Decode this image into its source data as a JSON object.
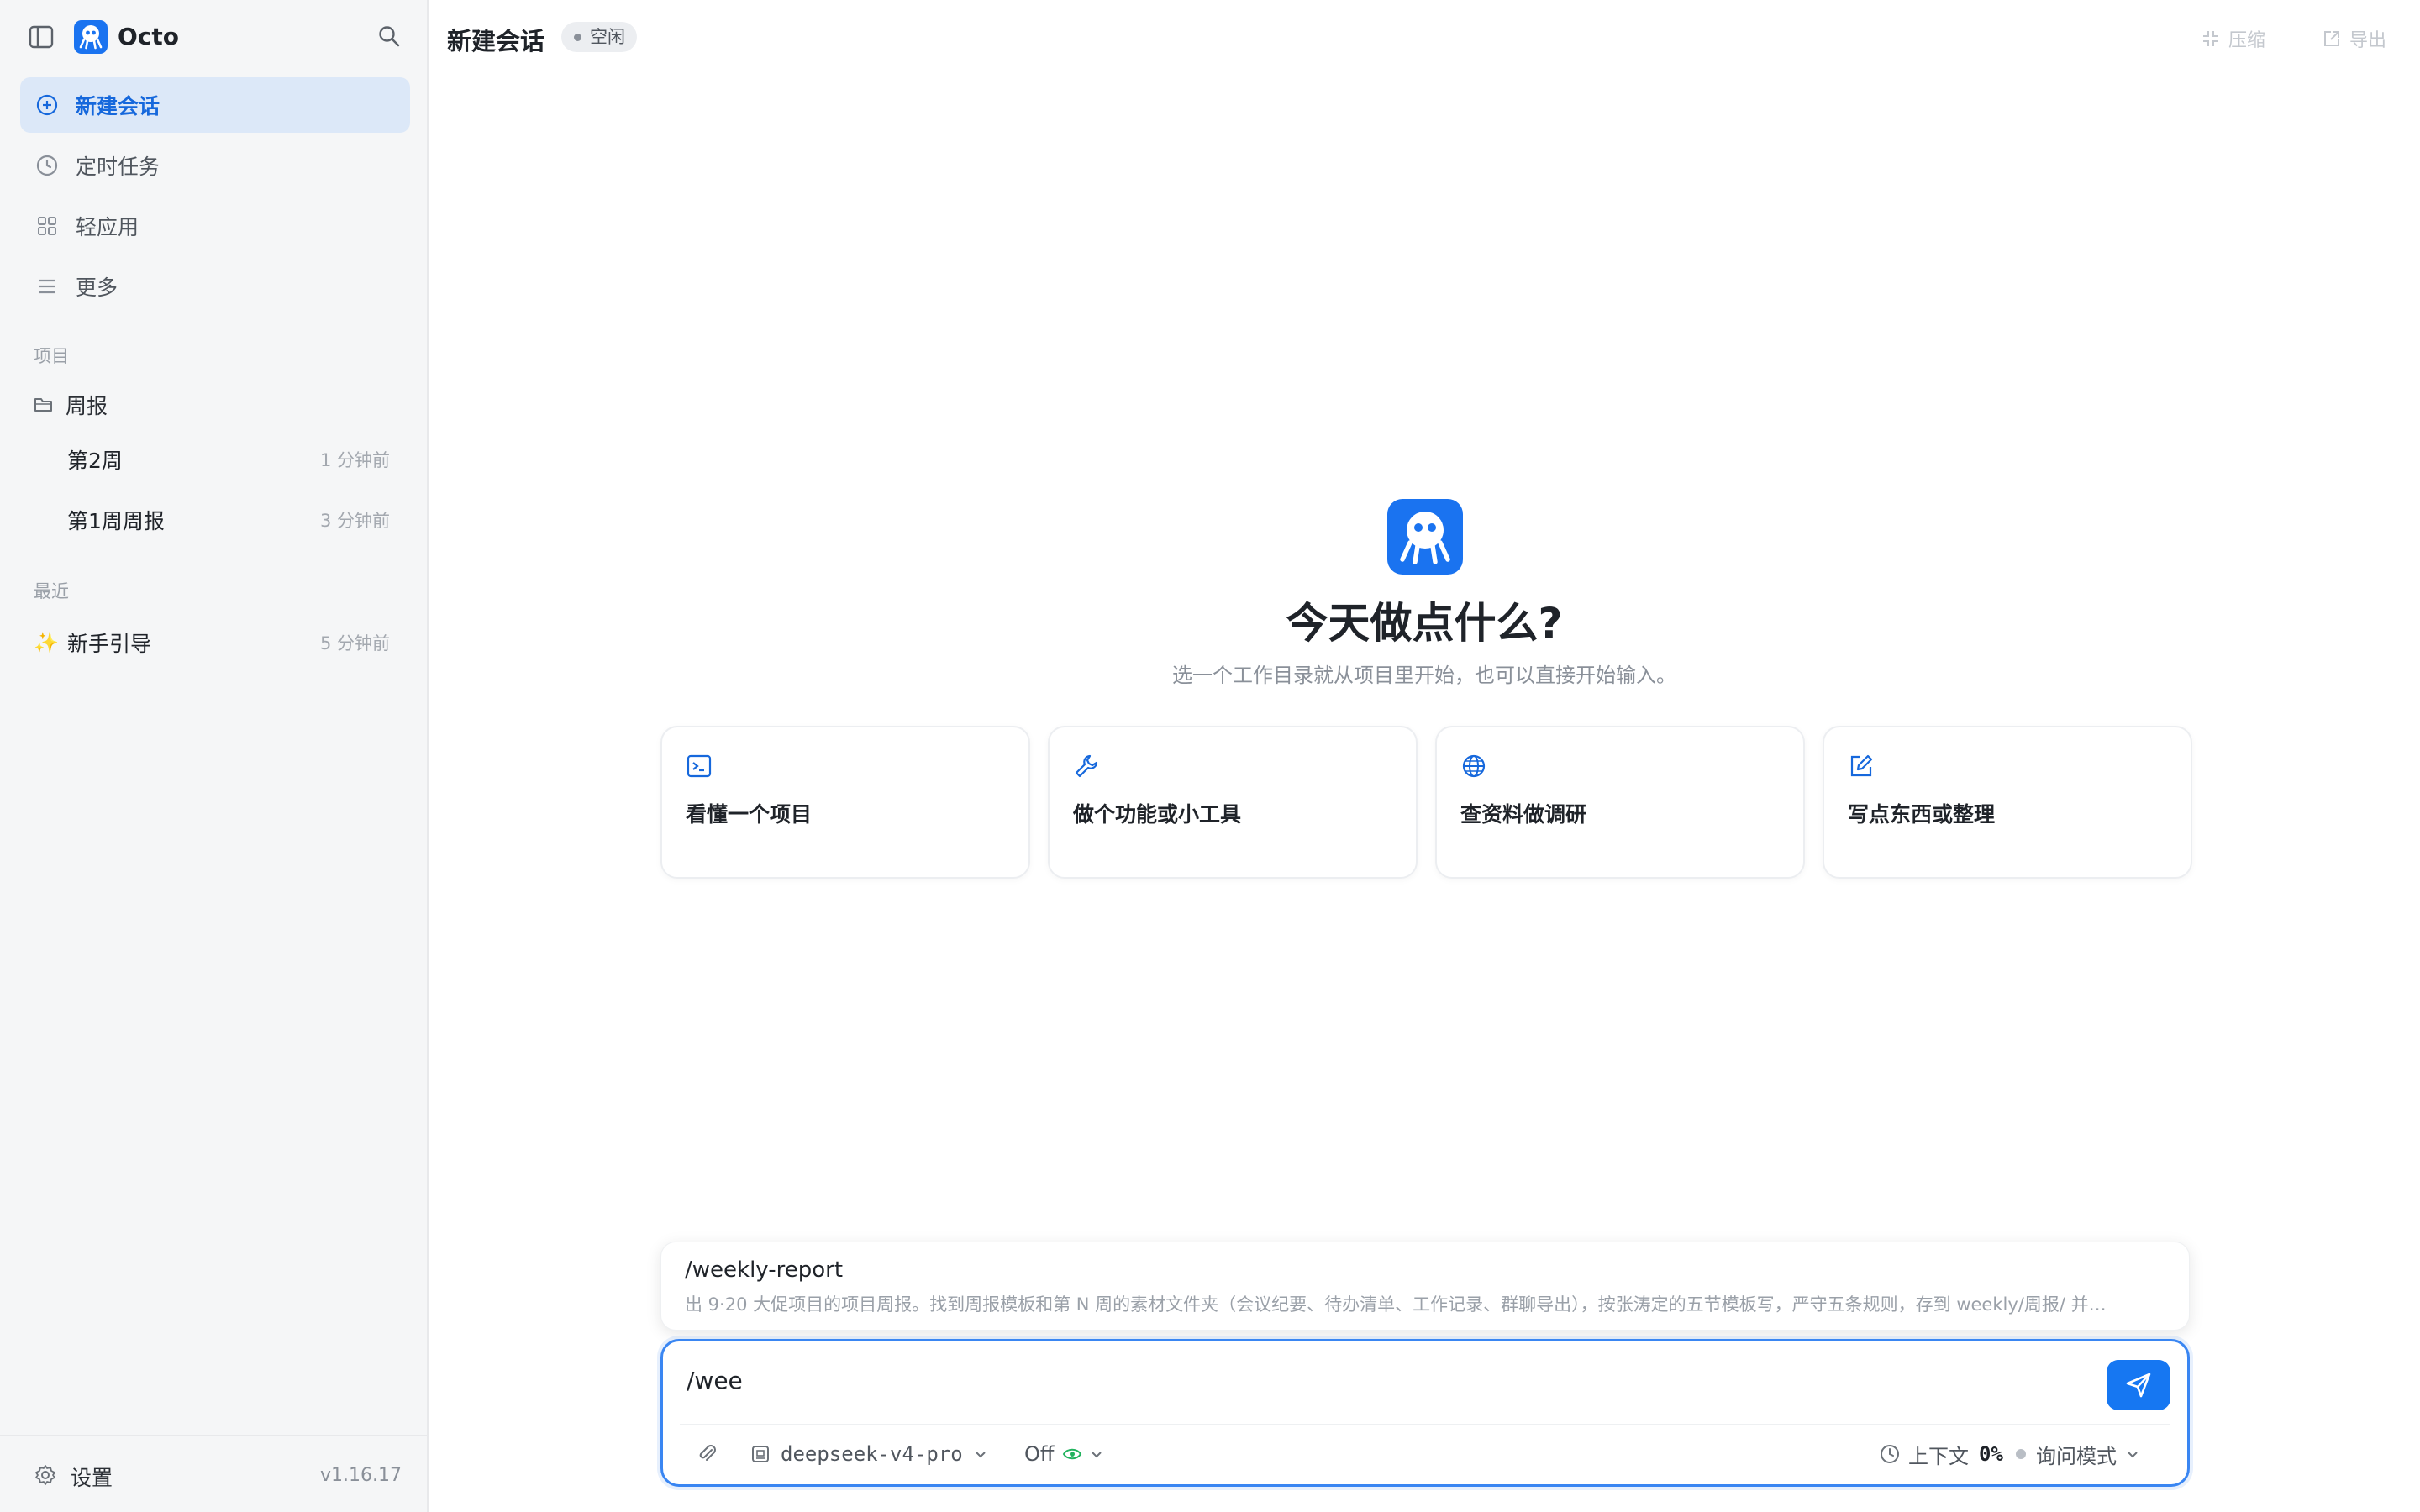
{
  "app": {
    "name": "Octo",
    "version": "v1.16.17"
  },
  "colors": {
    "accent": "#1677f2",
    "active_nav_bg": "#dce8f8",
    "eye_green": "#22b35e"
  },
  "sidebar": {
    "nav": [
      {
        "label": "新建会话",
        "icon": "plus-circle-icon",
        "active": true
      },
      {
        "label": "定时任务",
        "icon": "clock-icon",
        "active": false
      },
      {
        "label": "轻应用",
        "icon": "grid-icon",
        "active": false
      },
      {
        "label": "更多",
        "icon": "menu-icon",
        "active": false
      }
    ],
    "projects_title": "项目",
    "folder": {
      "label": "周报",
      "icon": "folder-icon"
    },
    "project_items": [
      {
        "label": "第2周",
        "time": "1 分钟前"
      },
      {
        "label": "第1周周报",
        "time": "3 分钟前"
      }
    ],
    "recent_title": "最近",
    "recent_items": [
      {
        "label": "新手引导",
        "time": "5 分钟前",
        "icon": "sparkles-icon",
        "glyph": "✨"
      }
    ],
    "footer": {
      "settings_label": "设置"
    }
  },
  "header": {
    "title": "新建会话",
    "status": "空闲",
    "actions": [
      {
        "label": "压缩",
        "icon": "compress-icon"
      },
      {
        "label": "导出",
        "icon": "export-icon"
      }
    ]
  },
  "hero": {
    "title": "今天做点什么?",
    "subtitle": "选一个工作目录就从项目里开始，也可以直接开始输入。"
  },
  "cards": [
    {
      "label": "看懂一个项目",
      "icon": "terminal-icon"
    },
    {
      "label": "做个功能或小工具",
      "icon": "wrench-icon"
    },
    {
      "label": "查资料做调研",
      "icon": "globe-icon"
    },
    {
      "label": "写点东西或整理",
      "icon": "edit-icon"
    }
  ],
  "suggestion": {
    "command": "/weekly-report",
    "description": "出 9·20 大促项目的项目周报。找到周报模板和第 N 周的素材文件夹（会议纪要、待办清单、工作记录、群聊导出），按张涛定的五节模板写，严守五条规则，存到 weekly/周报/ 并…"
  },
  "composer": {
    "input_value": "/wee",
    "model": "deepseek-v4-pro",
    "thinking": "Off",
    "context_label": "上下文",
    "context_value": "0%",
    "mode": "询问模式"
  }
}
